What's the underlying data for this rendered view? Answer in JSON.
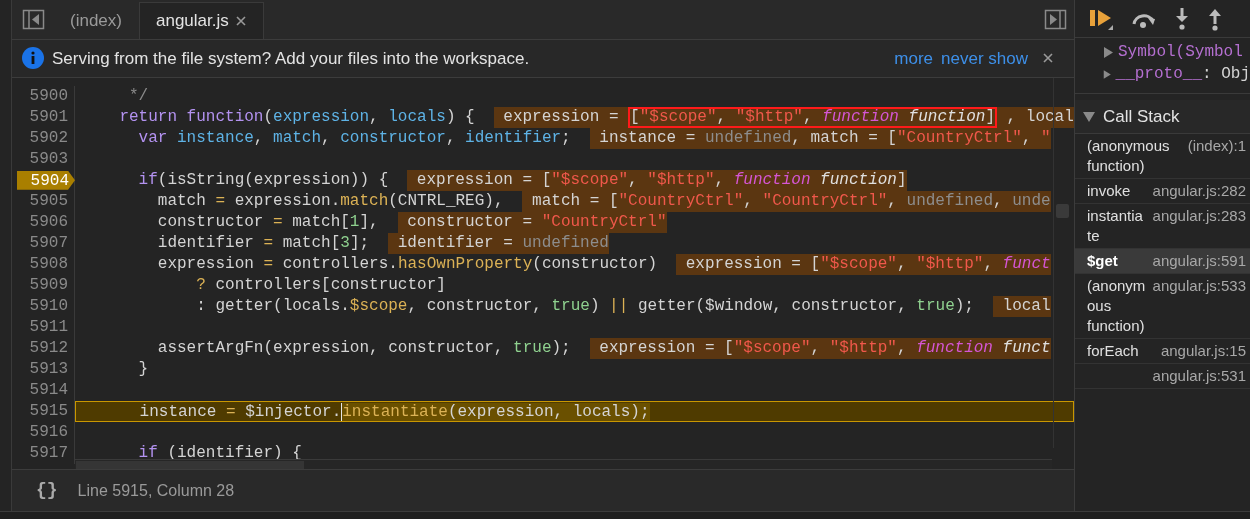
{
  "tabs": [
    {
      "label": "(index)",
      "selected": false,
      "closable": false
    },
    {
      "label": "angular.js",
      "selected": true,
      "closable": true
    }
  ],
  "infobar": {
    "message": "Serving from the file system? Add your files into the workspace.",
    "links": [
      "more",
      "never show"
    ]
  },
  "editor": {
    "lines": [
      {
        "number": "5900",
        "breakpoint": false,
        "current": false,
        "tokens": [
          {
            "kind": "comment",
            "text": "     */"
          }
        ]
      },
      {
        "number": "5901",
        "breakpoint": false,
        "current": false,
        "tokens": [
          {
            "kind": "kw",
            "text": "    return function"
          },
          {
            "kind": "plain",
            "text": "("
          },
          {
            "kind": "def",
            "text": "expression"
          },
          {
            "kind": "plain",
            "text": ", "
          },
          {
            "kind": "def",
            "text": "locals"
          },
          {
            "kind": "plain",
            "text": ") {"
          }
        ],
        "inline_value": [
          {
            "outlined": false,
            "tokens": [
              {
                "kind": "name",
                "text": "expression = "
              }
            ]
          },
          {
            "outlined": true,
            "tokens": [
              {
                "kind": "plain",
                "text": "["
              },
              {
                "kind": "str",
                "text": "\"$scope\""
              },
              {
                "kind": "plain",
                "text": ", "
              },
              {
                "kind": "str",
                "text": "\"$http\""
              },
              {
                "kind": "plain",
                "text": ", "
              },
              {
                "kind": "fn",
                "text": "function"
              },
              {
                "kind": "fn2",
                "text": " function"
              },
              {
                "kind": "plain",
                "text": "]"
              }
            ]
          },
          {
            "outlined": false,
            "tokens": [
              {
                "kind": "plain",
                "text": ", local"
              }
            ]
          }
        ]
      },
      {
        "number": "5902",
        "breakpoint": false,
        "current": false,
        "tokens": [
          {
            "kind": "kw",
            "text": "      var "
          },
          {
            "kind": "def",
            "text": "instance"
          },
          {
            "kind": "plain",
            "text": ", "
          },
          {
            "kind": "def",
            "text": "match"
          },
          {
            "kind": "plain",
            "text": ", "
          },
          {
            "kind": "def",
            "text": "constructor"
          },
          {
            "kind": "plain",
            "text": ", "
          },
          {
            "kind": "def",
            "text": "identifier"
          },
          {
            "kind": "plain",
            "text": ";"
          }
        ],
        "inline_value": [
          {
            "outlined": false,
            "tokens": [
              {
                "kind": "name",
                "text": "instance = "
              },
              {
                "kind": "undef",
                "text": "undefined"
              },
              {
                "kind": "plain",
                "text": ", match = ["
              },
              {
                "kind": "str",
                "text": "\"CountryCtrl\""
              },
              {
                "kind": "plain",
                "text": ", "
              },
              {
                "kind": "str",
                "text": "\""
              }
            ]
          }
        ]
      },
      {
        "number": "5903",
        "breakpoint": false,
        "current": false
      },
      {
        "number": "5904",
        "breakpoint": true,
        "current": false,
        "tokens": [
          {
            "kind": "kw",
            "text": "      if"
          },
          {
            "kind": "plain",
            "text": "(isString(expression)) {"
          }
        ],
        "inline_value": [
          {
            "outlined": false,
            "tokens": [
              {
                "kind": "name",
                "text": "expression = ["
              },
              {
                "kind": "str",
                "text": "\"$scope\""
              },
              {
                "kind": "plain",
                "text": ", "
              },
              {
                "kind": "str",
                "text": "\"$http\""
              },
              {
                "kind": "plain",
                "text": ", "
              },
              {
                "kind": "fn",
                "text": "function"
              },
              {
                "kind": "fn2",
                "text": " function"
              },
              {
                "kind": "plain",
                "text": "]"
              }
            ]
          }
        ]
      },
      {
        "number": "5905",
        "breakpoint": false,
        "current": false,
        "tokens": [
          {
            "kind": "plain",
            "text": "        match "
          },
          {
            "kind": "op",
            "text": "="
          },
          {
            "kind": "plain",
            "text": " expression."
          },
          {
            "kind": "method",
            "text": "match"
          },
          {
            "kind": "plain",
            "text": "(CNTRL_REG),"
          }
        ],
        "inline_value": [
          {
            "outlined": false,
            "tokens": [
              {
                "kind": "name",
                "text": "match = ["
              },
              {
                "kind": "str",
                "text": "\"CountryCtrl\""
              },
              {
                "kind": "plain",
                "text": ", "
              },
              {
                "kind": "str",
                "text": "\"CountryCtrl\""
              },
              {
                "kind": "plain",
                "text": ", "
              },
              {
                "kind": "undef",
                "text": "undefined"
              },
              {
                "kind": "plain",
                "text": ", "
              },
              {
                "kind": "undef",
                "text": "unde"
              }
            ]
          }
        ]
      },
      {
        "number": "5906",
        "breakpoint": false,
        "current": false,
        "tokens": [
          {
            "kind": "plain",
            "text": "        constructor "
          },
          {
            "kind": "op",
            "text": "="
          },
          {
            "kind": "plain",
            "text": " match["
          },
          {
            "kind": "num",
            "text": "1"
          },
          {
            "kind": "plain",
            "text": "],"
          }
        ],
        "inline_value": [
          {
            "outlined": false,
            "tokens": [
              {
                "kind": "name",
                "text": "constructor = "
              },
              {
                "kind": "str",
                "text": "\"CountryCtrl\""
              }
            ]
          }
        ]
      },
      {
        "number": "5907",
        "breakpoint": false,
        "current": false,
        "tokens": [
          {
            "kind": "plain",
            "text": "        identifier "
          },
          {
            "kind": "op",
            "text": "="
          },
          {
            "kind": "plain",
            "text": " match["
          },
          {
            "kind": "num",
            "text": "3"
          },
          {
            "kind": "plain",
            "text": "];"
          }
        ],
        "inline_value": [
          {
            "outlined": false,
            "tokens": [
              {
                "kind": "name",
                "text": "identifier = "
              },
              {
                "kind": "undef",
                "text": "undefined"
              }
            ]
          }
        ]
      },
      {
        "number": "5908",
        "breakpoint": false,
        "current": false,
        "tokens": [
          {
            "kind": "plain",
            "text": "        expression "
          },
          {
            "kind": "op",
            "text": "="
          },
          {
            "kind": "plain",
            "text": " controllers."
          },
          {
            "kind": "method",
            "text": "hasOwnProperty"
          },
          {
            "kind": "plain",
            "text": "(constructor)"
          }
        ],
        "inline_value": [
          {
            "outlined": false,
            "tokens": [
              {
                "kind": "name",
                "text": "expression = ["
              },
              {
                "kind": "str",
                "text": "\"$scope\""
              },
              {
                "kind": "plain",
                "text": ", "
              },
              {
                "kind": "str",
                "text": "\"$http\""
              },
              {
                "kind": "plain",
                "text": ", "
              },
              {
                "kind": "fn",
                "text": "funct"
              }
            ]
          }
        ]
      },
      {
        "number": "5909",
        "breakpoint": false,
        "current": false,
        "tokens": [
          {
            "kind": "op",
            "text": "            ?"
          },
          {
            "kind": "plain",
            "text": " controllers[constructor]"
          }
        ]
      },
      {
        "number": "5910",
        "breakpoint": false,
        "current": false,
        "tokens": [
          {
            "kind": "plain",
            "text": "            : getter(locals."
          },
          {
            "kind": "method",
            "text": "$scope"
          },
          {
            "kind": "plain",
            "text": ", constructor, "
          },
          {
            "kind": "num",
            "text": "true"
          },
          {
            "kind": "plain",
            "text": ") "
          },
          {
            "kind": "op",
            "text": "||"
          },
          {
            "kind": "plain",
            "text": " getter($window, constructor, "
          },
          {
            "kind": "num",
            "text": "true"
          },
          {
            "kind": "plain",
            "text": ");"
          }
        ],
        "inline_value": [
          {
            "outlined": false,
            "tokens": [
              {
                "kind": "name",
                "text": "local"
              }
            ]
          }
        ]
      },
      {
        "number": "5911",
        "breakpoint": false,
        "current": false
      },
      {
        "number": "5912",
        "breakpoint": false,
        "current": false,
        "tokens": [
          {
            "kind": "plain",
            "text": "        assertArgFn(expression, constructor, "
          },
          {
            "kind": "num",
            "text": "true"
          },
          {
            "kind": "plain",
            "text": ");"
          }
        ],
        "inline_value": [
          {
            "outlined": false,
            "tokens": [
              {
                "kind": "name",
                "text": "expression = ["
              },
              {
                "kind": "str",
                "text": "\"$scope\""
              },
              {
                "kind": "plain",
                "text": ", "
              },
              {
                "kind": "str",
                "text": "\"$http\""
              },
              {
                "kind": "plain",
                "text": ", "
              },
              {
                "kind": "fn",
                "text": "function"
              },
              {
                "kind": "fn2",
                "text": " funct"
              }
            ]
          }
        ]
      },
      {
        "number": "5913",
        "breakpoint": false,
        "current": false,
        "tokens": [
          {
            "kind": "plain",
            "text": "      }"
          }
        ]
      },
      {
        "number": "5914",
        "breakpoint": false,
        "current": false
      },
      {
        "number": "5915",
        "breakpoint": false,
        "current": true,
        "tokens": [
          {
            "kind": "plain",
            "text": "      instance "
          },
          {
            "kind": "op",
            "text": "="
          },
          {
            "kind": "plain",
            "text": " $injector."
          }
        ],
        "tokens_after_cursor": [
          {
            "kind": "method",
            "text": "instantiate"
          },
          {
            "kind": "plain",
            "text": "(expression, locals);"
          }
        ]
      },
      {
        "number": "5916",
        "breakpoint": false,
        "current": false
      },
      {
        "number": "5917",
        "breakpoint": false,
        "current": false,
        "tokens": [
          {
            "kind": "kw",
            "text": "      if"
          },
          {
            "kind": "plain",
            "text": " (identifier) {"
          }
        ]
      }
    ]
  },
  "status_bar": {
    "pretty_print": "{}",
    "position": "Line 5915, Column 28"
  },
  "scope": {
    "properties": [
      {
        "expanded": false,
        "tokens": [
          {
            "kind": "key",
            "text": "Symbol(Symbol"
          }
        ]
      },
      {
        "expanded": false,
        "tokens": [
          {
            "kind": "key",
            "text": "__proto__"
          },
          {
            "kind": "plain",
            "text": ": Obj"
          }
        ]
      }
    ]
  },
  "call_stack": {
    "title": "Call Stack",
    "expanded": true,
    "frames": [
      {
        "function": "(anonymous function)",
        "location": "(index):1",
        "selected": false
      },
      {
        "function": "invoke",
        "location": "angular.js:282",
        "selected": false
      },
      {
        "function": "instantiate",
        "location": "angular.js:283",
        "selected": false
      },
      {
        "function": "$get",
        "location": "angular.js:591",
        "selected": true
      },
      {
        "function": "(anonymous function)",
        "location": "angular.js:533",
        "selected": false
      },
      {
        "function": "forEach",
        "location": "angular.js:15",
        "selected": false
      },
      {
        "location": "angular.js:531",
        "selected": false
      }
    ]
  }
}
